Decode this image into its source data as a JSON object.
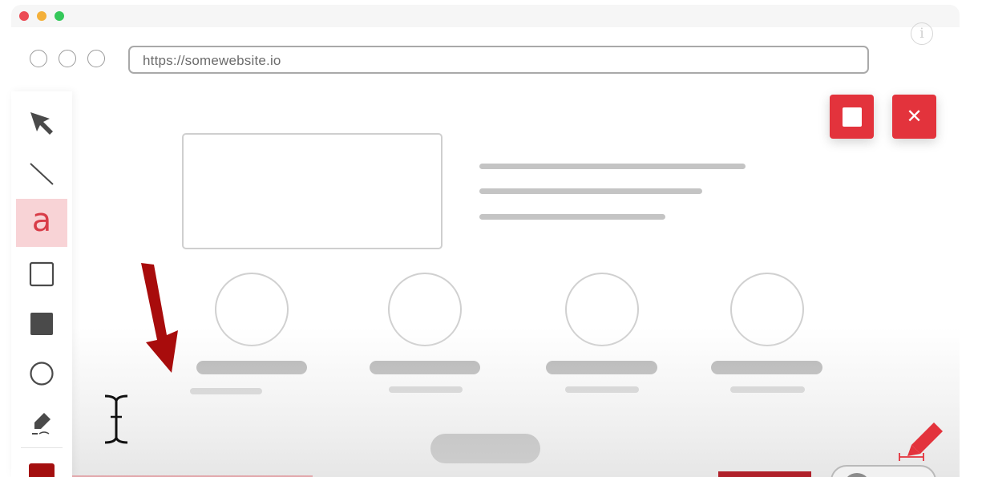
{
  "window": {
    "traffic_lights": [
      "#ec4c56",
      "#f4b03a",
      "#35c85a"
    ],
    "info_icon": "info-icon"
  },
  "browser": {
    "nav_circles": 3,
    "url": "https://somewebsite.io"
  },
  "toolbar": {
    "tools": [
      {
        "name": "pointer-arrow-icon",
        "active": false
      },
      {
        "name": "line-tool-icon",
        "active": false
      },
      {
        "name": "text-tool-icon",
        "label": "a",
        "active": true
      },
      {
        "name": "rectangle-outline-icon",
        "active": false
      },
      {
        "name": "rectangle-filled-icon",
        "active": false
      },
      {
        "name": "circle-outline-icon",
        "active": false
      },
      {
        "name": "highlighter-icon",
        "active": false
      }
    ],
    "selected_color": "#a40f0f",
    "active_bg": "#f8d3d6"
  },
  "recording": {
    "stop_icon": "stop-icon",
    "close_label": "✕",
    "color": "#e3333c"
  },
  "annotation": {
    "arrow_color": "#a80c0c",
    "cursor_icon": "text-cursor-icon"
  },
  "wireframe": {
    "cards": 4
  },
  "bottom": {
    "pencil_icon": "pencil-icon",
    "pencil_color": "#e3333c"
  }
}
